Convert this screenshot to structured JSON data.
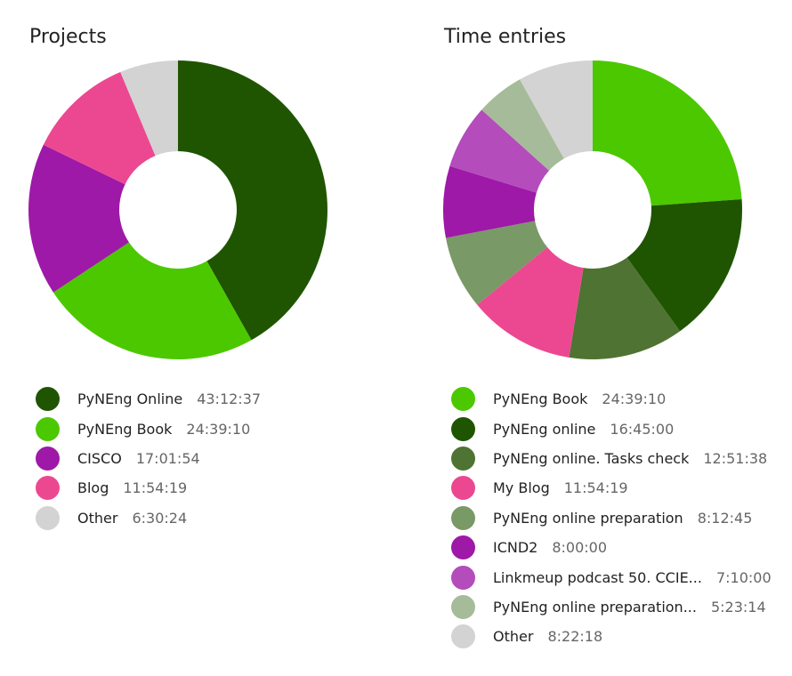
{
  "chart_data": [
    {
      "type": "pie",
      "title": "Projects",
      "donut": true,
      "slices": [
        {
          "label": "PyNEng Online",
          "time": "43:12:37",
          "value": 155557,
          "color": "#1f5500"
        },
        {
          "label": "PyNEng Book",
          "time": "24:39:10",
          "value": 88750,
          "color": "#4cc800"
        },
        {
          "label": "CISCO",
          "time": "17:01:54",
          "value": 61314,
          "color": "#9e19a8"
        },
        {
          "label": "Blog",
          "time": "11:54:19",
          "value": 42859,
          "color": "#ec4891"
        },
        {
          "label": "Other",
          "time": "6:30:24",
          "value": 23424,
          "color": "#d3d3d3"
        }
      ]
    },
    {
      "type": "pie",
      "title": "Time entries",
      "donut": true,
      "slices": [
        {
          "label": "PyNEng Book",
          "time": "24:39:10",
          "value": 88750,
          "color": "#4cc800"
        },
        {
          "label": "PyNEng online",
          "time": "16:45:00",
          "value": 60300,
          "color": "#1f5500"
        },
        {
          "label": "PyNEng online. Tasks check",
          "time": "12:51:38",
          "value": 46298,
          "color": "#4f7332"
        },
        {
          "label": "My Blog",
          "time": "11:54:19",
          "value": 42859,
          "color": "#ec4891"
        },
        {
          "label": "PyNEng online preparation",
          "time": "8:12:45",
          "value": 29565,
          "color": "#799966"
        },
        {
          "label": "ICND2",
          "time": "8:00:00",
          "value": 28800,
          "color": "#9e19a8"
        },
        {
          "label": "Linkmeup podcast 50. CCIE...",
          "time": "7:10:00",
          "value": 25800,
          "color": "#b44cbc"
        },
        {
          "label": "PyNEng online preparation...",
          "time": "5:23:14",
          "value": 19394,
          "color": "#a6bb99"
        },
        {
          "label": "Other",
          "time": "8:22:18",
          "value": 30138,
          "color": "#d3d3d3"
        }
      ]
    }
  ]
}
